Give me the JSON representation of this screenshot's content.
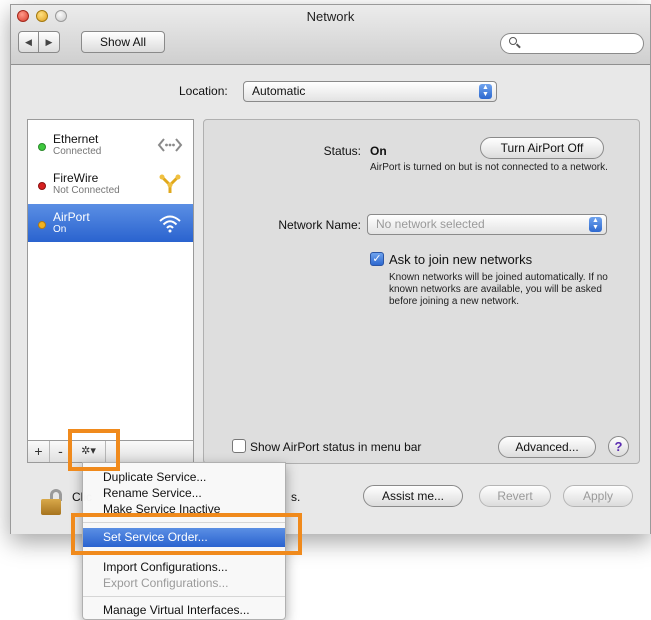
{
  "window": {
    "title": "Network"
  },
  "toolbar": {
    "back_glyph": "◀",
    "forward_glyph": "▶",
    "show_all_label": "Show All",
    "search_placeholder": ""
  },
  "location": {
    "label": "Location:",
    "value": "Automatic"
  },
  "services": [
    {
      "name": "Ethernet",
      "status": "Connected",
      "status_color": "#3ec83e",
      "icon": "ethernet-arrows-icon"
    },
    {
      "name": "FireWire",
      "status": "Not Connected",
      "status_color": "#d62020",
      "icon": "firewire-icon"
    },
    {
      "name": "AirPort",
      "status": "On",
      "status_color": "#f2b31f",
      "icon": "wifi-icon",
      "selected": true
    }
  ],
  "list_bar": {
    "add": "+",
    "remove": "-",
    "gear": "✲▾"
  },
  "detail": {
    "status_label": "Status:",
    "status_value": "On",
    "turn_off_button": "Turn AirPort Off",
    "status_note": "AirPort is turned on but is not connected to a network.",
    "network_name_label": "Network Name:",
    "network_name_placeholder": "No network selected",
    "ask_join_label": "Ask to join new networks",
    "ask_join_checked": true,
    "ask_join_note": "Known networks will be joined automatically. If no known networks are available, you will be asked before joining a new network.",
    "show_status_label": "Show AirPort status in menu bar",
    "show_status_checked": false,
    "advanced_button": "Advanced...",
    "help_glyph": "?"
  },
  "bottom": {
    "lock_text_left": "Clic",
    "lock_text_right": "s.",
    "assist_button": "Assist me...",
    "revert_button": "Revert",
    "apply_button": "Apply"
  },
  "context_menu": {
    "items": [
      {
        "label": "Duplicate Service...",
        "enabled": true
      },
      {
        "label": "Rename Service...",
        "enabled": true
      },
      {
        "label": "Make Service Inactive",
        "enabled": true
      },
      {
        "label": "Set Service Order...",
        "enabled": true,
        "highlighted": true
      },
      {
        "label": "Import Configurations...",
        "enabled": true
      },
      {
        "label": "Export Configurations...",
        "enabled": false
      },
      {
        "label": "Manage Virtual Interfaces...",
        "enabled": true
      }
    ]
  },
  "colors": {
    "accent_blue": "#2a63cf",
    "highlight_orange": "#f08a1c"
  }
}
